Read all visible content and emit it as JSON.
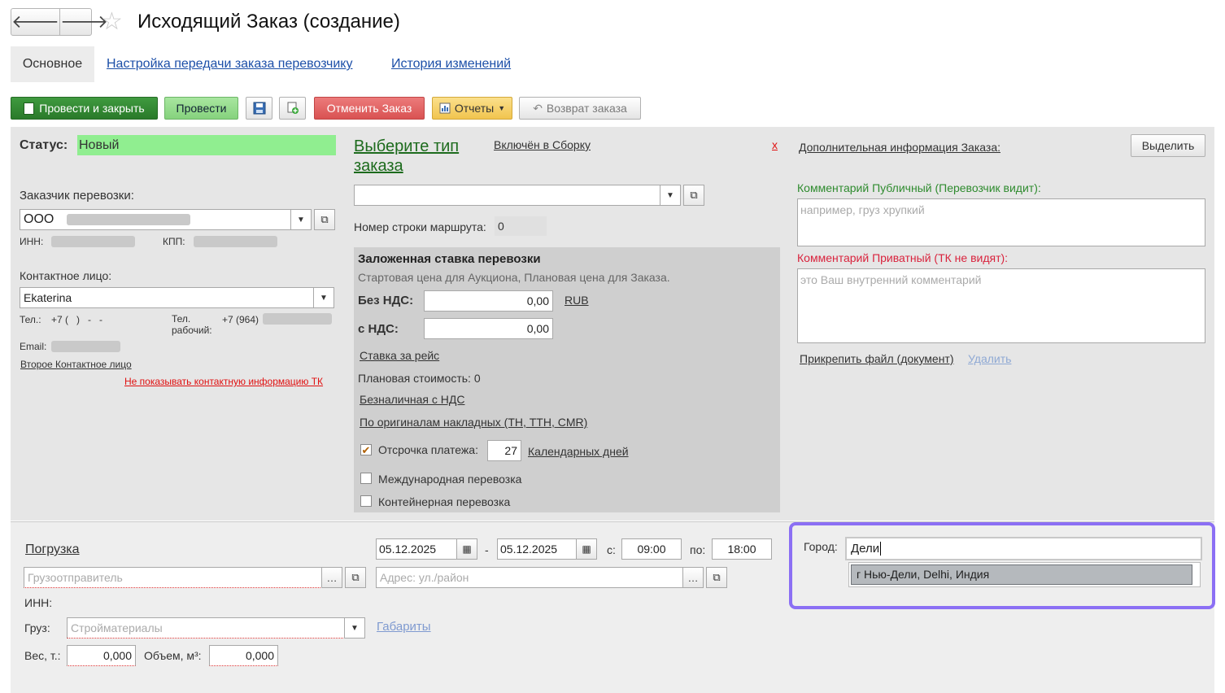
{
  "header": {
    "back_glyph": "🡐",
    "forward_glyph": "🡒",
    "star_glyph": "☆",
    "title": "Исходящий Заказ (создание)"
  },
  "tabs": {
    "main": "Основное",
    "carrier_settings": "Настройка передачи заказа перевозчику",
    "history": "История изменений"
  },
  "toolbar": {
    "post_close": "Провести и закрыть",
    "post": "Провести",
    "cancel_order": "Отменить Заказ",
    "reports": "Отчеты",
    "return_order": "Возврат заказа"
  },
  "status": {
    "label": "Статус:",
    "value": "Новый"
  },
  "customer": {
    "label": "Заказчик перевозки:",
    "value": "ООО",
    "inn_label": "ИНН:",
    "kpp_label": "КПП:"
  },
  "contact": {
    "label": "Контактное лицо:",
    "value": "Ekaterina",
    "phone_label": "Тел.:",
    "phone_value": "+7 (   )   -   -",
    "work_phone_label": "Тел. рабочий:",
    "work_phone_value": "+7 (964)",
    "email_label": "Email:",
    "second_contact": "Второе Контактное лицо",
    "hide_contact": "Не показывать контактную информацию ТК"
  },
  "order_type": {
    "heading": "Выберите тип заказа",
    "included_assembly": "Включён в Сборку",
    "remove_x": "x",
    "route_row_label": "Номер строки маршрута:",
    "route_row_value": "0"
  },
  "rate": {
    "title": "Заложенная ставка перевозки",
    "subtitle": "Стартовая цена для Аукциона, Плановая цена для Заказа.",
    "without_vat_label": "Без НДС:",
    "without_vat_value": "0,00",
    "currency": "RUB",
    "with_vat_label": "с НДС:",
    "with_vat_value": "0,00",
    "rate_per_trip": "Ставка за рейс",
    "planned_cost": "Плановая стоимость: 0",
    "cashless_vat": "Безналичная с НДС",
    "originals": "По оригиналам накладных (ТН, ТТН, CMR)",
    "deferral_label": "Отсрочка платежа:",
    "deferral_value": "27",
    "deferral_unit": "Календарных дней",
    "deferral_checked": true,
    "international_label": "Международная перевозка",
    "container_label": "Контейнерная перевозка"
  },
  "right": {
    "extra_info": "Дополнительная информация Заказа:",
    "highlight_button": "Выделить",
    "public_comment_label": "Комментарий Публичный (Перевозчик видит):",
    "public_comment_placeholder": "например, груз хрупкий",
    "private_comment_label": "Комментарий Приватный (ТК не видят):",
    "private_comment_placeholder": "это Ваш внутренний комментарий",
    "attach_file": "Прикрепить файл (документ)",
    "delete": "Удалить"
  },
  "loading": {
    "title": "Погрузка",
    "shipper_placeholder": "Грузоотправитель",
    "date_from": "05.12.2025",
    "dash": "-",
    "date_to": "05.12.2025",
    "from_label": "с:",
    "time_from": "09:00",
    "to_label": "по:",
    "time_to": "18:00",
    "address_placeholder": "Адрес: ул./район",
    "inn_label": "ИНН:",
    "cargo_label": "Груз:",
    "cargo_placeholder": "Стройматериалы",
    "dimensions": "Габариты",
    "weight_label": "Вес, т.:",
    "weight_value": "0,000",
    "volume_label": "Объем, м³:",
    "volume_value": "0,000"
  },
  "city": {
    "label": "Город:",
    "input_value": "Дели",
    "suggestion": "г Нью-Дели, Delhi, Индия"
  },
  "colors": {
    "status_bg": "#90ee90",
    "highlight_border": "#8b6ff4",
    "private_comment": "#d9233d",
    "public_comment": "#2e8b2e"
  }
}
